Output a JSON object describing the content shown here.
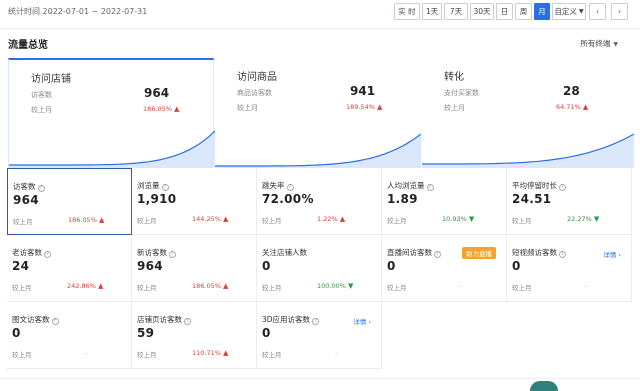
{
  "date_range": "统计时间 2022-07-01 ~ 2022-07-31",
  "time_buttons": [
    "实 时",
    "1天",
    "7天",
    "30天",
    "日",
    "周",
    "月",
    "自定义"
  ],
  "active_time_button": "月",
  "nav": {
    "prev": "‹",
    "next": "›"
  },
  "section_title": "流量总览",
  "channel_select": "所有终端",
  "accent_color": "#2a6ee6",
  "up_color": "#d9423c",
  "down_color": "#2d9a3e",
  "funnel": [
    {
      "title": "访问店铺",
      "label": "访客数",
      "value": "964",
      "compare": "较上月",
      "pct": "186.05%",
      "trend": "up"
    },
    {
      "title": "访问商品",
      "label": "商品访客数",
      "value": "941",
      "compare": "较上月",
      "pct": "189.54%",
      "trend": "up"
    },
    {
      "title": "转化",
      "label": "支付买家数",
      "value": "28",
      "compare": "较上月",
      "pct": "64.71%",
      "trend": "up"
    }
  ],
  "metrics": [
    {
      "name": "访客数",
      "value": "964",
      "compare": "较上月",
      "pct": "186.05%",
      "trend": "up",
      "info": true
    },
    {
      "name": "浏览量",
      "value": "1,910",
      "compare": "较上月",
      "pct": "144.25%",
      "trend": "up",
      "info": true
    },
    {
      "name": "跳失率",
      "value": "72.00%",
      "compare": "较上月",
      "pct": "1.22%",
      "trend": "up",
      "info": true
    },
    {
      "name": "人均浏览量",
      "value": "1.89",
      "compare": "较上月",
      "pct": "10.93%",
      "trend": "down",
      "info": true
    },
    {
      "name": "平均停留时长",
      "value": "24.51",
      "compare": "较上月",
      "pct": "22.27%",
      "trend": "down",
      "info": true
    },
    {
      "name": "老访客数",
      "value": "24",
      "compare": "较上月",
      "pct": "242.86%",
      "trend": "up",
      "info": true
    },
    {
      "name": "新访客数",
      "value": "964",
      "compare": "较上月",
      "pct": "186.05%",
      "trend": "up",
      "info": true
    },
    {
      "name": "关注店铺人数",
      "value": "0",
      "compare": "较上月",
      "pct": "100.00%",
      "trend": "down",
      "info": false
    },
    {
      "name": "直播间访客数",
      "value": "0",
      "compare": "较上月",
      "pct": "-",
      "trend": "na",
      "info": true,
      "badge": "助力直播"
    },
    {
      "name": "短视频访客数",
      "value": "0",
      "compare": "较上月",
      "pct": "-",
      "trend": "na",
      "info": true,
      "detail": "详情 ›"
    },
    {
      "name": "图文访客数",
      "value": "0",
      "compare": "较上月",
      "pct": "-",
      "trend": "na",
      "info": true
    },
    {
      "name": "店铺页访客数",
      "value": "59",
      "compare": "较上月",
      "pct": "110.71%",
      "trend": "up",
      "info": true
    },
    {
      "name": "3D应用访客数",
      "value": "0",
      "compare": "较上月",
      "pct": "-",
      "trend": "na",
      "info": true,
      "detail": "详情 ›"
    }
  ]
}
